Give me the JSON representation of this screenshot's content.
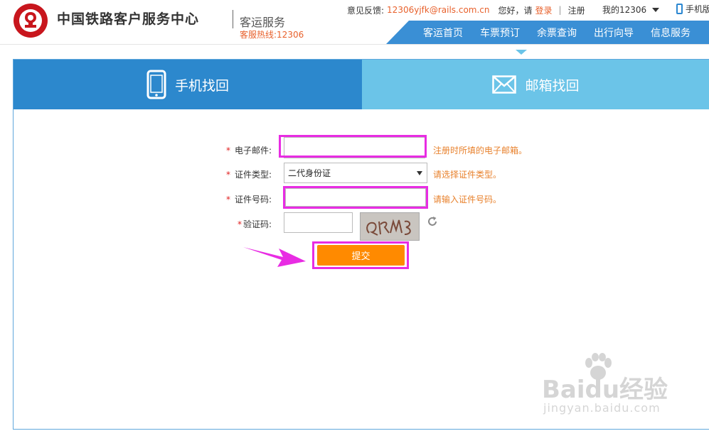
{
  "header": {
    "site_name": "中国铁路客户服务中心",
    "site_sub": "客运服务",
    "hotline": "客服热线:12306",
    "feedback_label": "意见反馈:",
    "feedback_email": "12306yjfk@rails.com.cn",
    "greeting": "您好，请",
    "login": "登录",
    "register": "注册",
    "my12306": "我的12306",
    "mobile": "手机版"
  },
  "nav": {
    "items": [
      {
        "label": "客运首页"
      },
      {
        "label": "车票预订"
      },
      {
        "label": "余票查询"
      },
      {
        "label": "出行向导"
      },
      {
        "label": "信息服务"
      }
    ]
  },
  "tabs": {
    "phone": "手机找回",
    "email": "邮箱找回"
  },
  "form": {
    "email_label": "电子邮件:",
    "email_value": "",
    "email_hint": "注册时所填的电子邮箱。",
    "idtype_label": "证件类型:",
    "idtype_value": "二代身份证",
    "idtype_hint": "请选择证件类型。",
    "idnum_label": "证件号码:",
    "idnum_value": "",
    "idnum_hint": "请输入证件号码。",
    "captcha_label": "验证码:",
    "captcha_value": "",
    "submit": "提交"
  },
  "watermark": {
    "big": "Baidu经验",
    "small": "jingyan.baidu.com"
  },
  "colors": {
    "brand_red": "#c8161d",
    "nav_blue": "#3a8fd5",
    "tab_active": "#2c88cd",
    "tab_inactive": "#6bc4e8",
    "accent_orange": "#ff8a00",
    "highlight_magenta": "#e82ce3"
  }
}
